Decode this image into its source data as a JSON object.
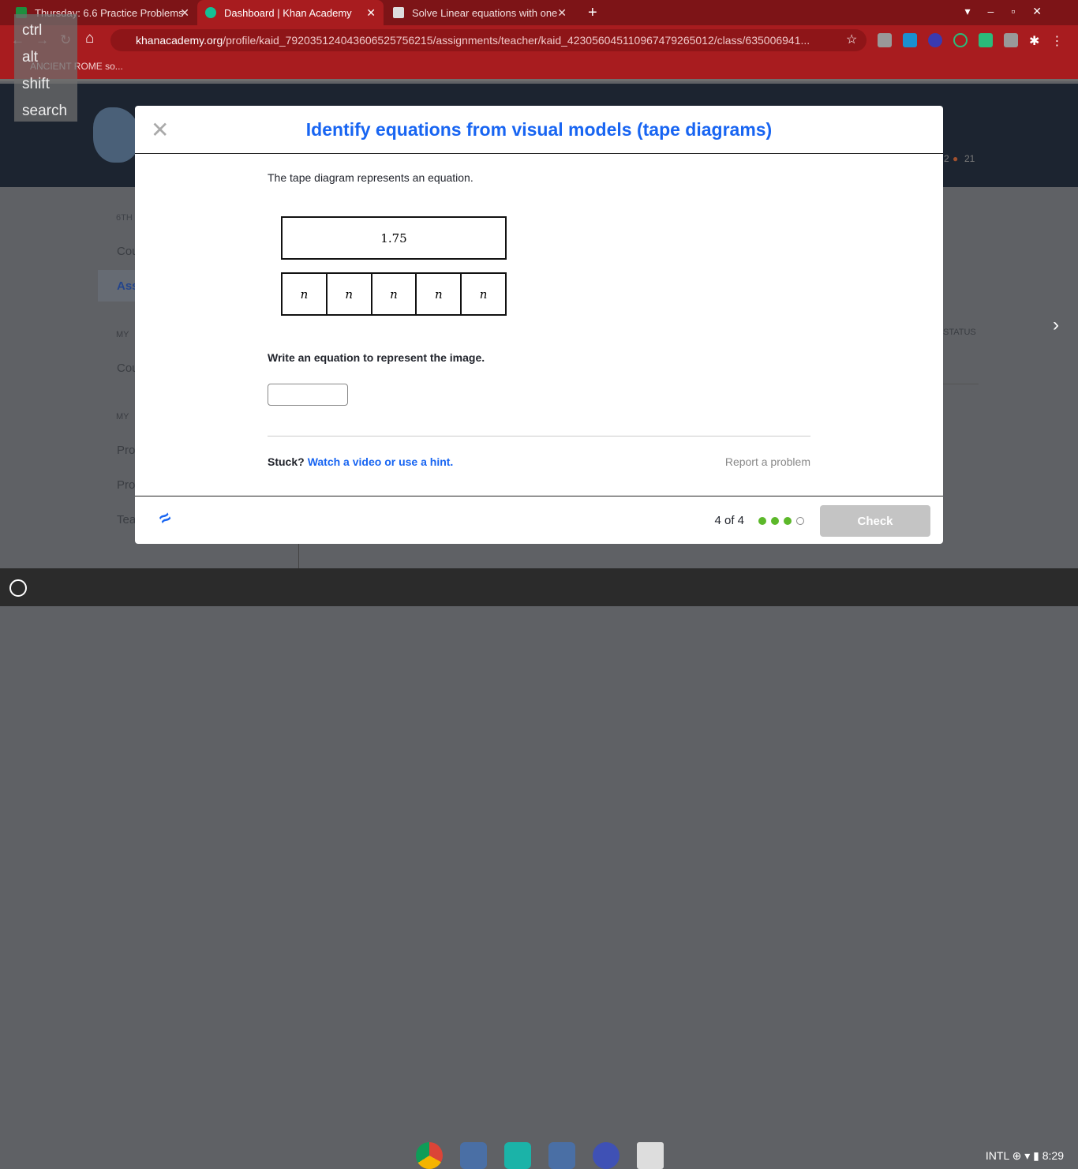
{
  "browser": {
    "tabs": [
      {
        "title": "Thursday: 6.6 Practice Problems"
      },
      {
        "title": "Dashboard | Khan Academy"
      },
      {
        "title": "Solve Linear equations with one"
      }
    ],
    "url_host": "khanacademy.org",
    "url_path": "/profile/kaid_792035124043606525756215/assignments/teacher/kaid_423056045110967479265012/class/635006941...",
    "bookmark": "ANCIENT ROME so..."
  },
  "keyboard_overlay": [
    "ctrl",
    "alt",
    "shift",
    "search"
  ],
  "background": {
    "sidebar": [
      "6TH",
      "Cou",
      "Ass",
      "MY",
      "Cou",
      "MY",
      "Pro",
      "Pro",
      "Tea"
    ],
    "status_header": "STATUS",
    "stats": "2",
    "streak": "21"
  },
  "modal": {
    "title": "Identify equations from visual models (tape diagrams)",
    "question": "The tape diagram represents an equation.",
    "tape_total": "1.75",
    "tape_cells": [
      "n",
      "n",
      "n",
      "n",
      "n"
    ],
    "prompt": "Write an equation to represent the image.",
    "answer_value": "",
    "stuck": "Stuck?",
    "hint_link": "Watch a video or use a hint.",
    "report": "Report a problem",
    "progress": "4 of 4",
    "progress_dots": [
      true,
      true,
      true,
      false
    ],
    "check": "Check"
  },
  "shelf": {
    "ime": "INTL",
    "time": "8:29"
  }
}
